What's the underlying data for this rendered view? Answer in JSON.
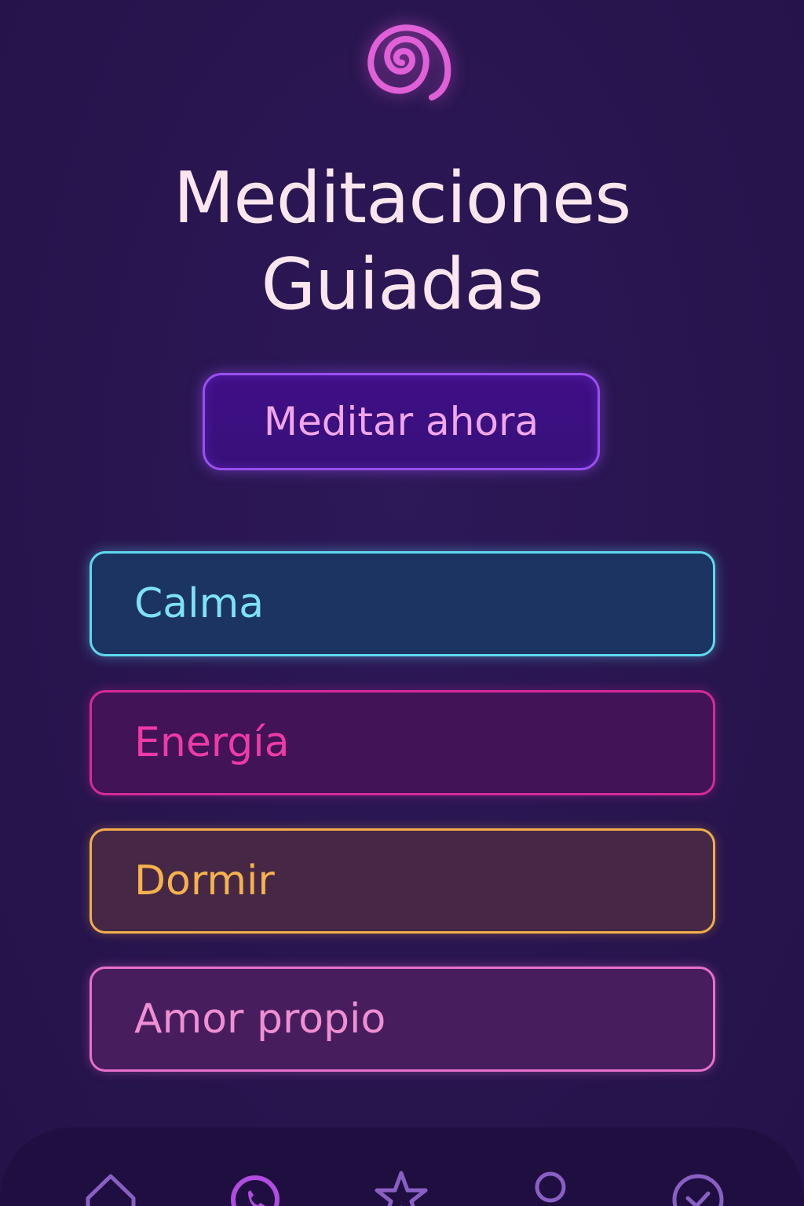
{
  "header": {
    "logo_icon": "spiral-icon",
    "title_line1": "Meditaciones",
    "title_line2": "Guiadas"
  },
  "cta": {
    "label": "Meditar ahora"
  },
  "categories": [
    {
      "label": "Calma",
      "color": "#5fd8ee"
    },
    {
      "label": "Energía",
      "color": "#d62a9a"
    },
    {
      "label": "Dormir",
      "color": "#f2ad4a"
    },
    {
      "label": "Amor propio",
      "color": "#e96fcd"
    }
  ],
  "nav": {
    "items": [
      {
        "icon": "home-icon"
      },
      {
        "icon": "phone-circle-icon"
      },
      {
        "icon": "star-icon"
      },
      {
        "icon": "profile-icon"
      },
      {
        "icon": "check-circle-icon"
      }
    ]
  },
  "colors": {
    "background": "#28154e",
    "title": "#fbe6ee",
    "accent": "#9a4ff0",
    "logo": "#e060d8"
  }
}
